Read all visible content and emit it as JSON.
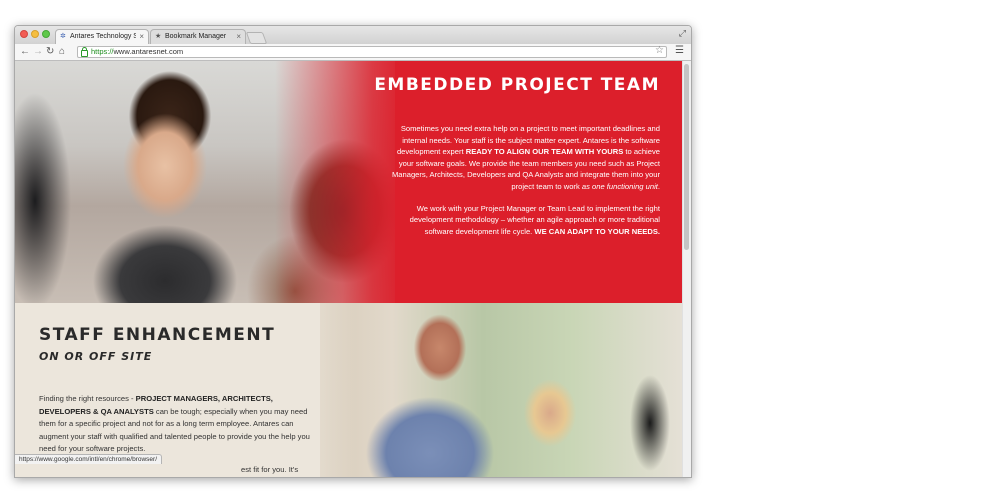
{
  "browser": {
    "tabs": [
      {
        "title": "Antares Technology Solution",
        "active": true,
        "favicon": "antares-favicon-icon"
      },
      {
        "title": "Bookmark Manager",
        "active": false,
        "favicon": "star-icon"
      }
    ],
    "address": {
      "scheme": "https://",
      "host": "www.antaresnet.com"
    },
    "status_url": "https://www.google.com/intl/en/chrome/browser/"
  },
  "embedded": {
    "title": "EMBEDDED PROJECT TEAM",
    "p1_a": "Sometimes you need extra help on a project to meet important deadlines and internal needs. Your staff is the subject matter expert. Antares is the software development expert ",
    "p1_b": "READY TO ALIGN OUR TEAM WITH YOURS",
    "p1_c": " to achieve your software goals. We provide the team members you need such as Project Managers, Architects, Developers and QA Analysts and integrate them into your project team to work ",
    "p1_d": "as one functioning unit",
    "p1_e": ".",
    "p2_a": "We work with your Project Manager or Team Lead to implement the right development methodology – whether an agile approach or more traditional software development life cycle. ",
    "p2_b": "WE CAN ADAPT TO YOUR NEEDS."
  },
  "staff": {
    "title": "STAFF ENHANCEMENT",
    "subtitle": "ON OR OFF SITE",
    "body_a": "Finding the right resources - ",
    "body_b": "PROJECT MANAGERS, ARCHITECTS, DEVELOPERS & QA ANALYSTS",
    "body_c": " can be tough; especially when you may need them for a specific project and not for as a long term employee. Antares can augment your staff with qualified and talented people to provide you the help you need for your software projects.",
    "tail": "est fit for you. It's"
  }
}
